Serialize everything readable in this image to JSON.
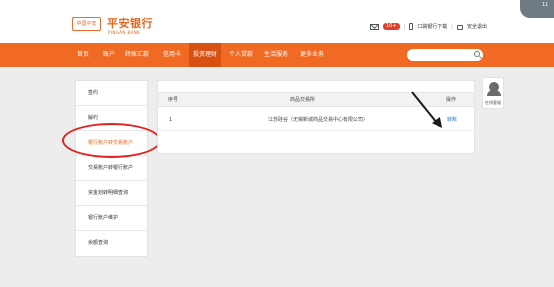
{
  "header": {
    "logo_badge": "中国平安",
    "logo_cn": "平安银行",
    "logo_en": "PINGAN BANK",
    "msg_count": "10+",
    "download": "口袋银行下载",
    "logout": "安全退出",
    "corner_text": "11"
  },
  "nav": {
    "items": [
      {
        "label": "首页"
      },
      {
        "label": "账户"
      },
      {
        "label": "转账汇款"
      },
      {
        "label": "信用卡"
      },
      {
        "label": "投资理财"
      },
      {
        "label": "个人贷款"
      },
      {
        "label": "生活服务"
      },
      {
        "label": "更多业务"
      }
    ],
    "active_index": 4
  },
  "sidebar": {
    "items": [
      {
        "label": "签约"
      },
      {
        "label": "解约"
      },
      {
        "label": "银行账户转交易账户"
      },
      {
        "label": "交易账户转银行账户"
      },
      {
        "label": "资金划转明细查询"
      },
      {
        "label": "银行账户维护"
      },
      {
        "label": "余额查询"
      }
    ],
    "active_index": 2
  },
  "table": {
    "headers": {
      "no": "序号",
      "exchange": "商品交易所",
      "op": "操作"
    },
    "rows": [
      {
        "no": "1",
        "exchange": "江苏硅谷（无锡新城商品交易中心有限公司）",
        "op": "转账"
      }
    ]
  },
  "service": {
    "label": "在线客服"
  },
  "colors": {
    "brand": "#f06a24",
    "nav_active": "#d95112",
    "highlight": "#e02323",
    "link": "#2a74c9"
  }
}
